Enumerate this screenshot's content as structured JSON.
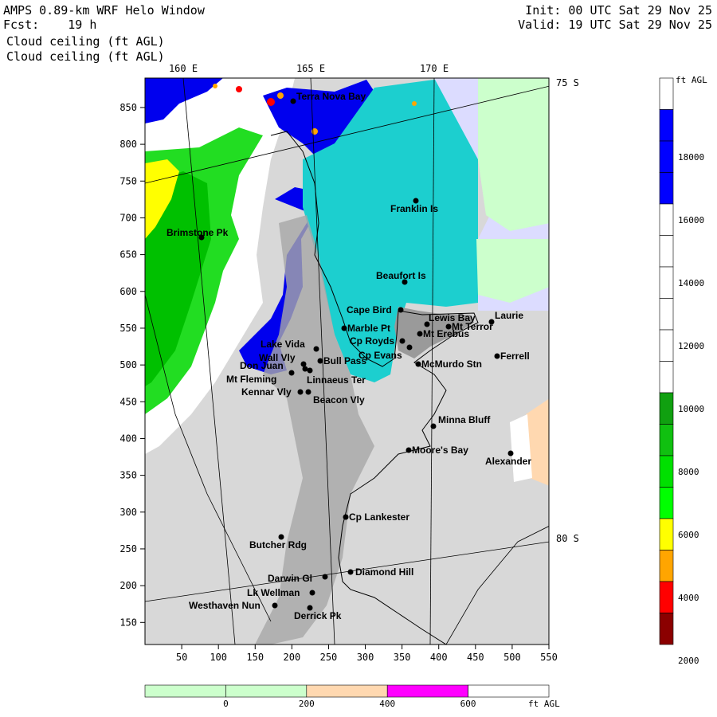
{
  "header": {
    "model_title": "AMPS 0.89-km WRF Helo Window",
    "forecast": "Fcst:    19 h",
    "field1": "Cloud ceiling (ft AGL)",
    "field2": "Cloud ceiling (ft AGL)",
    "init": "Init: 00 UTC Sat 29 Nov 25",
    "valid": "Valid: 19 UTC Sat 29 Nov 25"
  },
  "map": {
    "lon_labels": [
      "160 E",
      "165 E",
      "170 E"
    ],
    "lat_labels": [
      "75 S",
      "80 S"
    ],
    "x_ticks": [
      "50",
      "100",
      "150",
      "200",
      "250",
      "300",
      "350",
      "400",
      "450",
      "500",
      "550"
    ],
    "y_ticks": [
      "850",
      "800",
      "750",
      "700",
      "650",
      "600",
      "550",
      "500",
      "450",
      "400",
      "350",
      "300",
      "250",
      "200",
      "150"
    ],
    "places": [
      {
        "name": "Terra Nova Bay",
        "x": 368,
        "y": 126
      },
      {
        "name": "Franklin Is",
        "x": 522,
        "y": 252
      },
      {
        "name": "Brimstone Pk",
        "x": 253,
        "y": 298
      },
      {
        "name": "Beaufort Is",
        "x": 508,
        "y": 354
      },
      {
        "name": "Cape Bird",
        "x": 503,
        "y": 389
      },
      {
        "name": "Lewis Bay",
        "x": 536,
        "y": 407
      },
      {
        "name": "Laurie",
        "x": 617,
        "y": 404
      },
      {
        "name": "Mt Terror",
        "x": 563,
        "y": 410
      },
      {
        "name": "Marble Pt",
        "x": 432,
        "y": 412
      },
      {
        "name": "Cp Royds",
        "x": 505,
        "y": 428
      },
      {
        "name": "Mt Erebus",
        "x": 527,
        "y": 419
      },
      {
        "name": "Lake Vida",
        "x": 397,
        "y": 438
      },
      {
        "name": "Cp Evans",
        "x": 514,
        "y": 436
      },
      {
        "name": "Ferrell",
        "x": 624,
        "y": 447
      },
      {
        "name": "Wall Vly",
        "x": 381,
        "y": 457
      },
      {
        "name": "Bull Pass",
        "x": 402,
        "y": 453
      },
      {
        "name": "McMurdo Stn",
        "x": 525,
        "y": 457
      },
      {
        "name": "Don Juan",
        "x": 383,
        "y": 463
      },
      {
        "name": "Mt Fleming",
        "x": 366,
        "y": 468
      },
      {
        "name": "Linnaeus Ter",
        "x": 389,
        "y": 465
      },
      {
        "name": "Kennar Vly",
        "x": 377,
        "y": 492
      },
      {
        "name": "Beacon Vly",
        "x": 387,
        "y": 492
      },
      {
        "name": "Minna Bluff",
        "x": 544,
        "y": 535
      },
      {
        "name": "Moore's Bay",
        "x": 513,
        "y": 565
      },
      {
        "name": "Alexander",
        "x": 641,
        "y": 569
      },
      {
        "name": "Cp Lankester",
        "x": 434,
        "y": 649
      },
      {
        "name": "Butcher Rdg",
        "x": 353,
        "y": 674
      },
      {
        "name": "Diamond Hill",
        "x": 440,
        "y": 718
      },
      {
        "name": "Darwin Gl",
        "x": 408,
        "y": 724
      },
      {
        "name": "Lk Wellman",
        "x": 392,
        "y": 744
      },
      {
        "name": "Westhaven Nun",
        "x": 345,
        "y": 760
      },
      {
        "name": "Derrick Pk",
        "x": 389,
        "y": 763
      }
    ]
  },
  "colorbar": {
    "unit": "ft AGL",
    "ticks": [
      "18000",
      "16000",
      "14000",
      "12000",
      "10000",
      "8000",
      "6000",
      "4000",
      "2000"
    ],
    "colors": [
      "#ffffff",
      "#0000ff",
      "#0000ff",
      "#0000ff",
      "#ffffff",
      "#ffffff",
      "#ffffff",
      "#ffffff",
      "#ffffff",
      "#ffffff",
      "#10a010",
      "#10c010",
      "#00e000",
      "#00ff00",
      "#ffff00",
      "#ffa500",
      "#ff0000",
      "#8b0000"
    ]
  },
  "bottom_bar": {
    "unit": "ft AGL",
    "ticks": [
      "0",
      "200",
      "400",
      "600"
    ],
    "colors": [
      "#ccffcc",
      "#ccffcc",
      "#ffd8b0",
      "#ff00ff",
      "#ffffff"
    ]
  }
}
